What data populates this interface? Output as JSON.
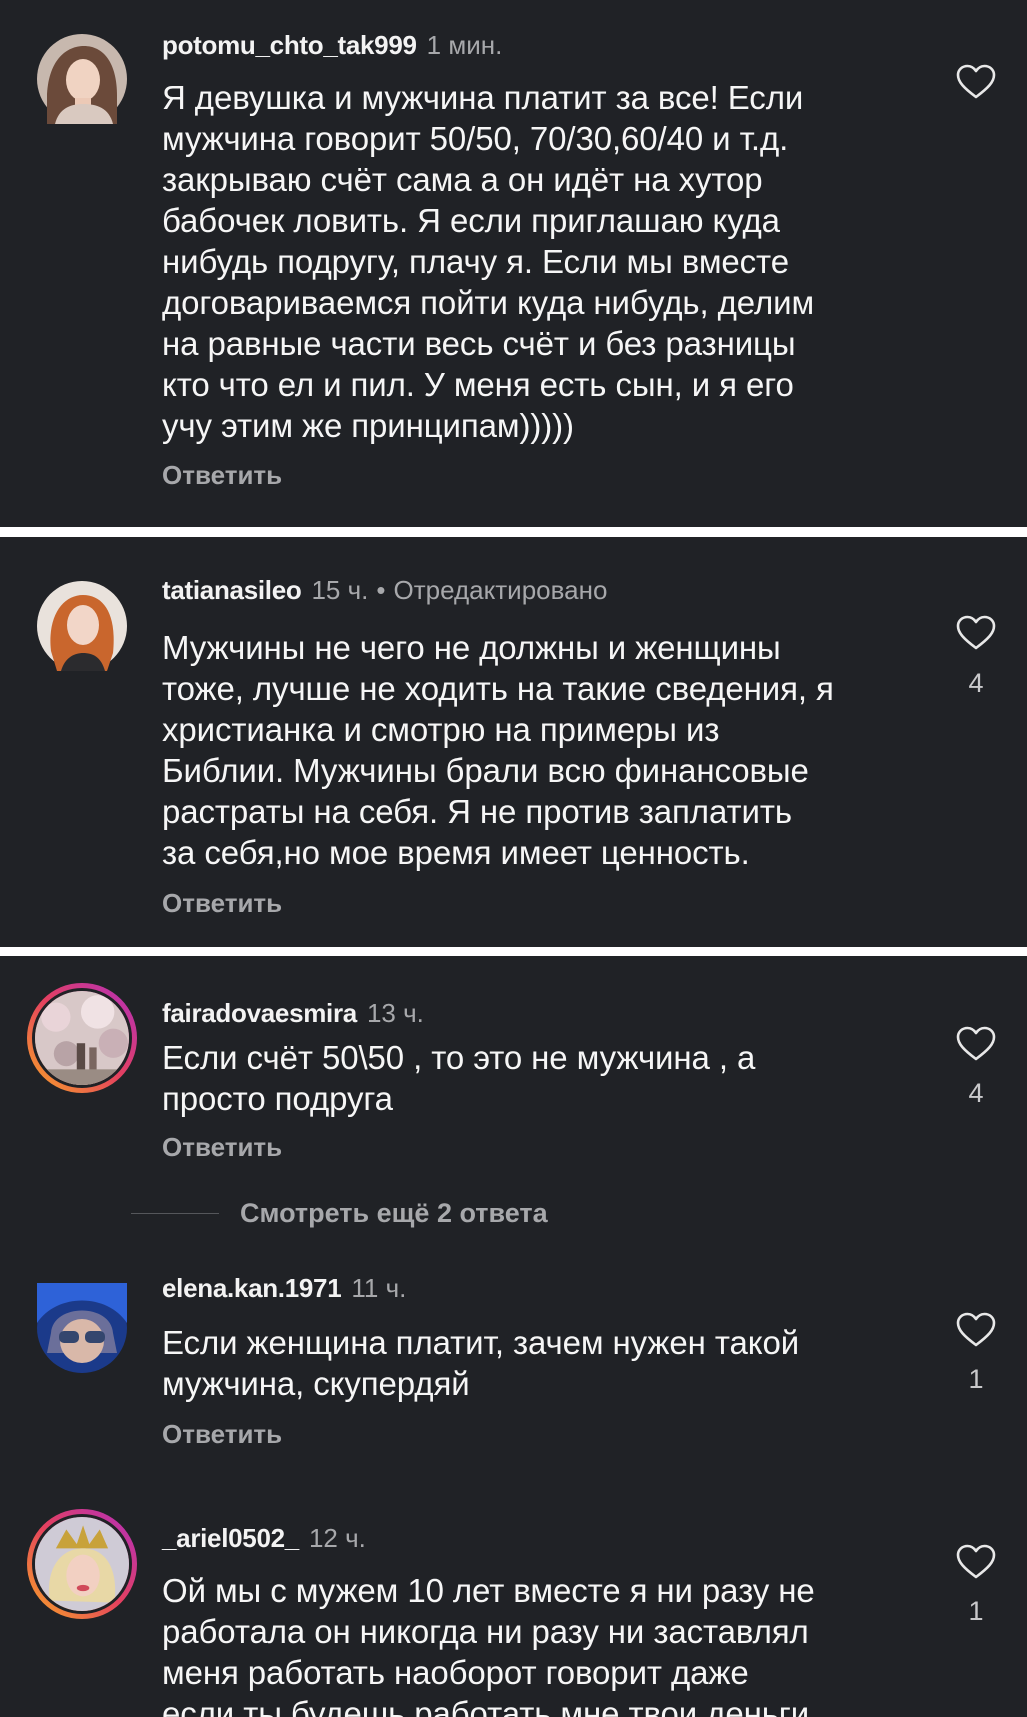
{
  "comments": [
    {
      "username": "potomu_chto_tak999",
      "time": "1 мин.",
      "text": "Я девушка и мужчина платит за все! Если\nмужчина говорит 50/50, 70/30,60/40 и т.д.\nзакрываю счёт сама а он идёт на хутор\nбабочек ловить. Я если приглашаю куда\nнибудь подругу, плачу я. Если мы вместе\nдоговариваемся пойти куда нибудь, делим\nна равные части весь счёт и без разницы\nкто что ел и пил. У меня есть сын, и я его\nучу этим же принципам)))))",
      "reply_label": "Ответить",
      "likes": ""
    },
    {
      "username": "tatianasileo",
      "time": "15 ч.",
      "dot": "•",
      "edited": "Отредактировано",
      "text": "Мужчины не чего не должны и женщины\nтоже, лучше не ходить на такие сведения, я\nхристианка и смотрю на примеры из\nБиблии. Мужчины брали всю финансовые\nрастраты на себя. Я не против заплатить\nза себя,но мое время имеет ценность.",
      "reply_label": "Ответить",
      "likes": "4"
    },
    {
      "username": "fairadovaesmira",
      "time": "13 ч.",
      "text": "Если счёт 50\\50 , то это не мужчина , а\nпросто подруга",
      "reply_label": "Ответить",
      "likes": "4"
    },
    {
      "username": "elena.kan.1971",
      "time": "11 ч.",
      "text": "Если женщина платит, зачем нужен такой\nмужчина, скупердяй",
      "reply_label": "Ответить",
      "likes": "1"
    },
    {
      "username": "_ariel0502_",
      "time": "12 ч.",
      "text": "Ой мы с мужем 10 лет вместе я ни разу не\nработала он никогда ни разу ни заставлял\nменя работать наоборот говорит даже\nесли ты  будешь работать мне твои деньги",
      "reply_label": "",
      "likes": "1"
    }
  ],
  "view_more": "Смотреть ещё 2 ответа",
  "icons": {
    "like": "heart-outline-icon"
  },
  "colors": {
    "background": "#202226",
    "text": "#f6f6f6",
    "muted": "#a7a8ab",
    "separator": "#ffffff",
    "story_ring_start": "#f6a623",
    "story_ring_end": "#c837ab"
  }
}
